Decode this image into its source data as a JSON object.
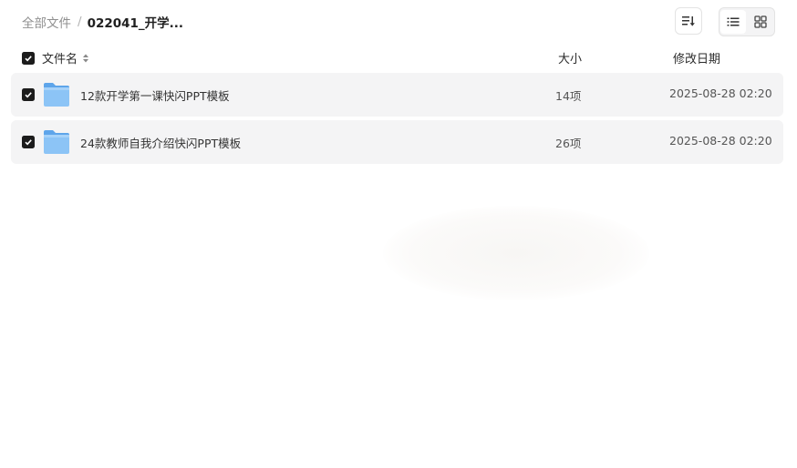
{
  "breadcrumb": {
    "root": "全部文件",
    "separator": "/",
    "current": "022041_开学..."
  },
  "toolbar": {
    "sort_icon": "sort-desc-icon",
    "views": [
      {
        "name": "list-view",
        "icon": "list-icon",
        "active": true
      },
      {
        "name": "grid-view",
        "icon": "grid-icon",
        "active": false
      }
    ]
  },
  "table": {
    "columns": {
      "name": "文件名",
      "size": "大小",
      "date": "修改日期"
    },
    "select_all_checked": true,
    "rows": [
      {
        "name": "12款开学第一课快闪PPT模板",
        "size": "14项",
        "date": "2025-08-28 02:20",
        "checked": true,
        "type": "folder"
      },
      {
        "name": "24款教师自我介绍快闪PPT模板",
        "size": "26项",
        "date": "2025-08-28 02:20",
        "checked": true,
        "type": "folder"
      }
    ]
  },
  "colors": {
    "row_bg": "#f4f4f5",
    "checkbox": "#1c1c1c",
    "folder": "#7cb8f0"
  }
}
